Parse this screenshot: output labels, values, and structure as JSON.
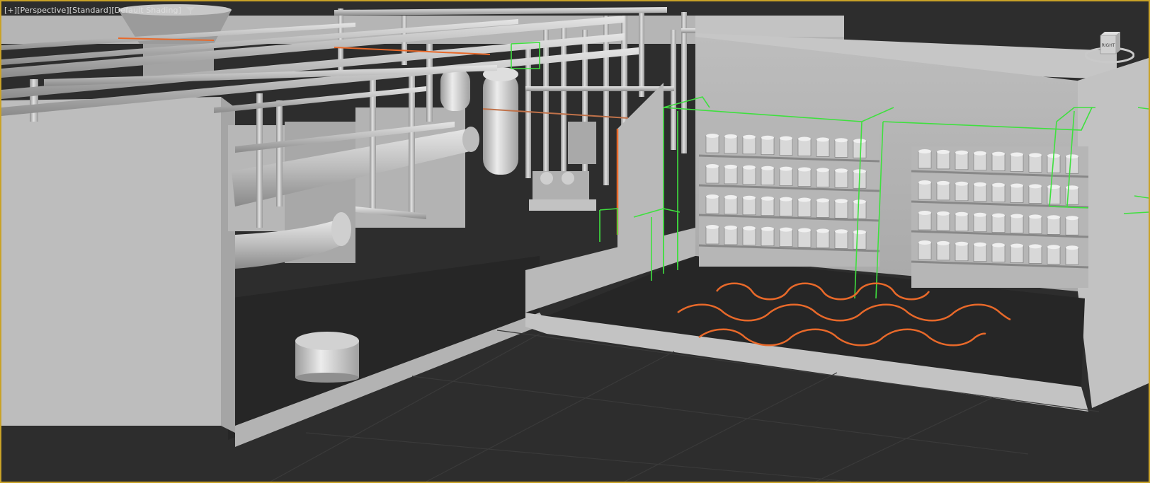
{
  "viewport": {
    "labels": {
      "plus": "[+]",
      "view": "[Perspective]",
      "render_style": "[Standard]",
      "shading": "[Default Shading]"
    },
    "icons": {
      "filter": "filter-icon",
      "viewcube": "viewcube-icon"
    },
    "viewcube_face": "RIGHT",
    "colors": {
      "border_active": "#c9a227",
      "background": "#2d2d2d",
      "geometry": "#b9b9b9",
      "selection_green": "#3fe03f",
      "highlight_orange": "#e8692a"
    }
  }
}
